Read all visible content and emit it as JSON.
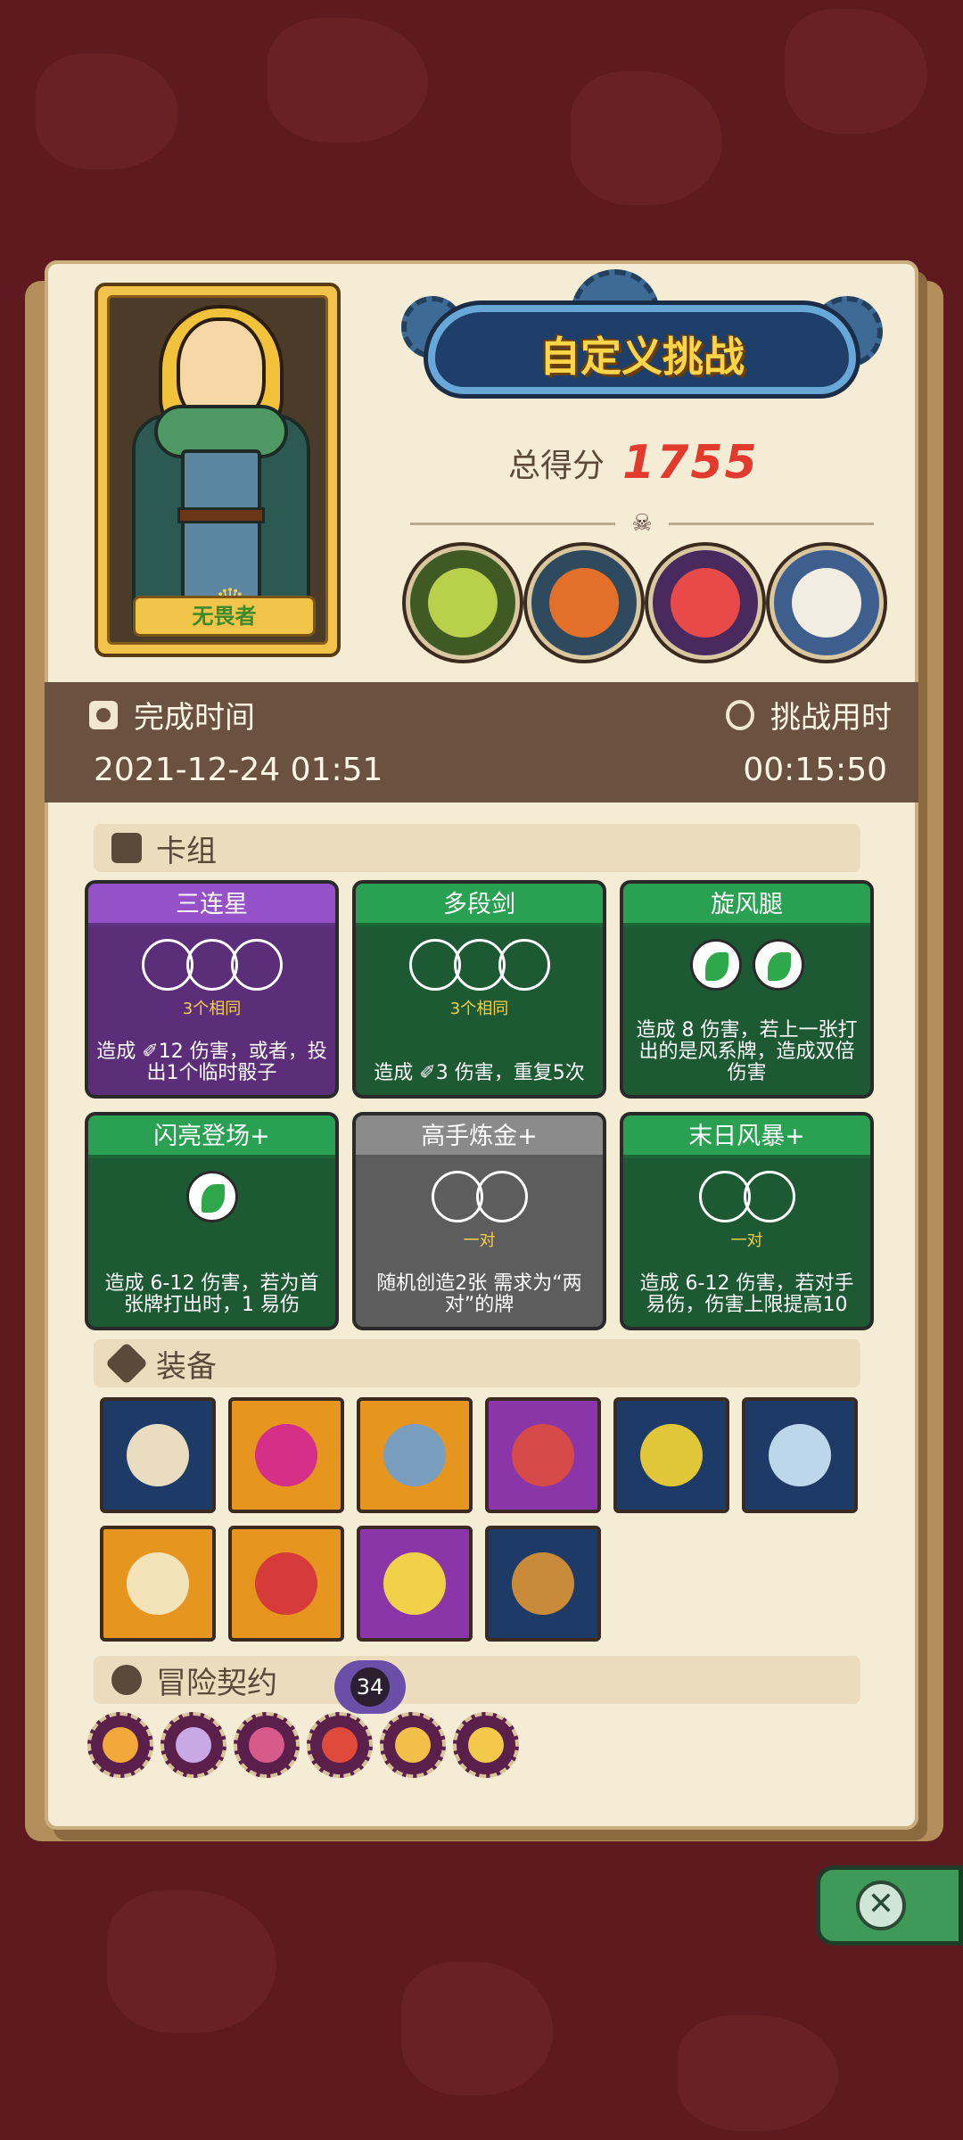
{
  "hero": {
    "name": "无畏者"
  },
  "header": {
    "title": "自定义挑战",
    "score_label": "总得分",
    "score_value": "1755"
  },
  "bosses": [
    "boss-croc",
    "boss-ogre",
    "boss-masked",
    "boss-skeleton-king"
  ],
  "completion": {
    "date_label": "完成时间",
    "date_value": "2021-12-24 01:51",
    "duration_label": "挑战用时",
    "duration_value": "00:15:50"
  },
  "deck": {
    "heading": "卡组",
    "cards": [
      {
        "title": "三连星",
        "color": "purple",
        "slot_count": 3,
        "element": false,
        "sub": "3个相同",
        "desc": "造成 ✐12 伤害，或者，投出1个临时骰子"
      },
      {
        "title": "多段剑",
        "color": "green",
        "slot_count": 3,
        "element": false,
        "sub": "3个相同",
        "desc": "造成 ✐3 伤害，重复5次"
      },
      {
        "title": "旋风腿",
        "color": "green",
        "slot_count": 2,
        "element": true,
        "sub": "",
        "desc": "造成 8 伤害，若上一张打出的是风系牌，造成双倍伤害"
      },
      {
        "title": "闪亮登场+",
        "color": "green",
        "slot_count": 1,
        "element": true,
        "sub": "",
        "desc": "造成 6-12 伤害，若为首张牌打出时，1 易伤"
      },
      {
        "title": "高手炼金+",
        "color": "gray",
        "slot_count": 2,
        "element": false,
        "sub": "一对",
        "desc": "随机创造2张 需求为“两对”的牌"
      },
      {
        "title": "末日风暴+",
        "color": "green",
        "slot_count": 2,
        "element": false,
        "sub": "一对",
        "desc": "造成 6-12 伤害，若对手易伤，伤害上限提高10"
      }
    ]
  },
  "equipment": {
    "heading": "装备",
    "items": [
      {
        "name": "scroll",
        "bg": "#1e3a66",
        "color": "#e9dcc0"
      },
      {
        "name": "yin-yang-orb",
        "bg": "#e6951e",
        "color": "#d62f8a"
      },
      {
        "name": "horn",
        "bg": "#e6951e",
        "color": "#7a9ec0"
      },
      {
        "name": "red-idol",
        "bg": "#8a35a8",
        "color": "#d64a4a"
      },
      {
        "name": "cheese-bush",
        "bg": "#1e3a66",
        "color": "#e2c63a"
      },
      {
        "name": "star-emblem",
        "bg": "#1e3a66",
        "color": "#bcd6ea"
      },
      {
        "name": "round-shield",
        "bg": "#e6951e",
        "color": "#f4e2b8"
      },
      {
        "name": "demon-mask",
        "bg": "#e6951e",
        "color": "#d63a3a"
      },
      {
        "name": "moon-star",
        "bg": "#8a35a8",
        "color": "#f2d14a"
      },
      {
        "name": "seed-pod",
        "bg": "#1e3a66",
        "color": "#c98a3a"
      }
    ]
  },
  "contracts": {
    "heading": "冒险契约",
    "count": "34",
    "items": [
      {
        "name": "fire-contract",
        "color": "#f2a93a"
      },
      {
        "name": "spider-contract",
        "color": "#c9a8e6"
      },
      {
        "name": "skull-contract",
        "color": "#d65a8a"
      },
      {
        "name": "spiral-contract",
        "color": "#e04a3a"
      },
      {
        "name": "burst-contract",
        "color": "#f2c04a"
      },
      {
        "name": "wing-contract",
        "color": "#f2c94a"
      }
    ]
  },
  "colors": {
    "score": "#e23a2c",
    "panel": "#f5ecd5",
    "background": "#5e1a1f"
  }
}
